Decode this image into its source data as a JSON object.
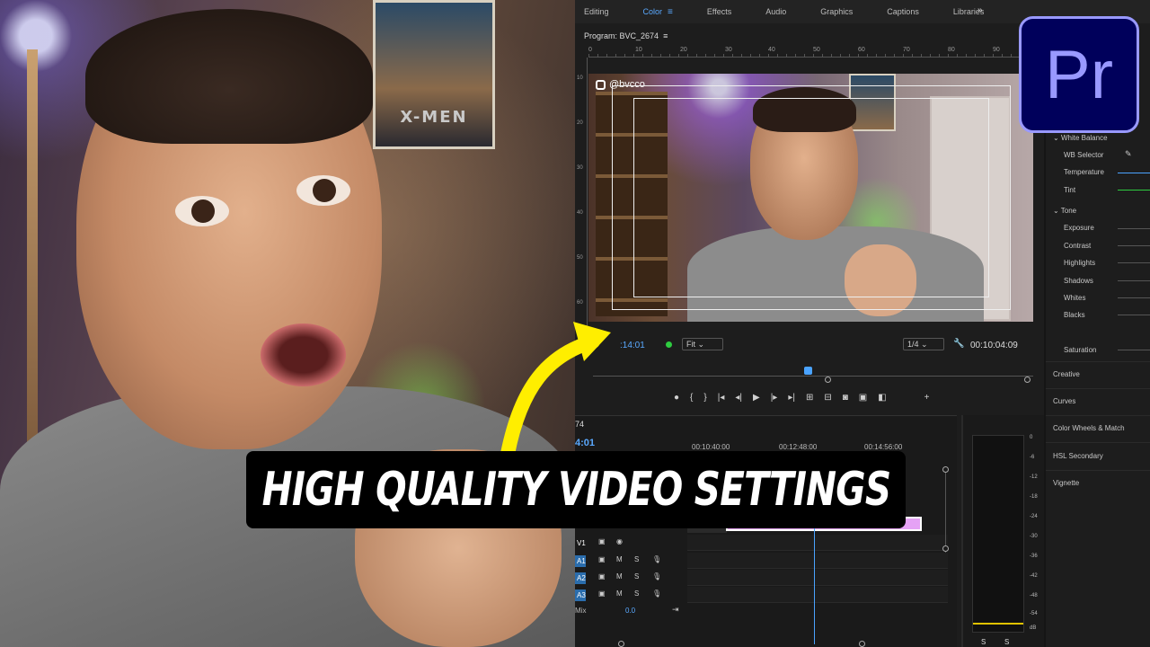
{
  "workspaces": {
    "tabs": [
      "Editing",
      "Color",
      "Effects",
      "Audio",
      "Graphics",
      "Captions",
      "Libraries"
    ],
    "active": "Color",
    "more_icon": "double-chevron-right-icon"
  },
  "program_monitor": {
    "title": "Program: BVC_2674",
    "ruler_labels": [
      "0",
      "10",
      "20",
      "30",
      "40",
      "50",
      "60",
      "70",
      "80",
      "90"
    ],
    "overlay_handle": "@bvcco",
    "current_timecode": ":14:01",
    "zoom": "Fit",
    "resolution": "1/4",
    "duration_timecode": "00:10:04:09"
  },
  "timeline": {
    "sequence_label": "74",
    "current_timecode": "4:01",
    "tick_labels": [
      "00:10:40:00",
      "00:12:48:00",
      "00:14:56:00"
    ],
    "tracks": [
      "V1",
      "A1",
      "A2",
      "A3"
    ],
    "track_buttons": [
      "M",
      "S"
    ],
    "mix_label": "Mix",
    "mix_value": "0.0"
  },
  "audio_meter": {
    "db_labels": [
      "0",
      "-6",
      "-12",
      "-18",
      "-24",
      "-30",
      "-36",
      "-42",
      "-48",
      "-54",
      "dB"
    ],
    "solo_labels": [
      "S",
      "S"
    ]
  },
  "lumetri": {
    "white_balance": "White Balance",
    "wb_selector": "WB Selector",
    "temperature": "Temperature",
    "tint": "Tint",
    "tone": "Tone",
    "exposure": "Exposure",
    "contrast": "Contrast",
    "highlights": "Highlights",
    "shadows": "Shadows",
    "whites": "Whites",
    "blacks": "Blacks",
    "saturation": "Saturation",
    "creative": "Creative",
    "curves": "Curves",
    "color_wheels": "Color Wheels & Match",
    "hsl": "HSL Secondary",
    "vignette": "Vignette"
  },
  "logo": "Pr",
  "thumbnail_title": "HIGH QUALITY VIDEO SETTINGS",
  "photo_poster_text": "X-MEN",
  "colors": {
    "accent_blue": "#5aa9ff",
    "arrow_yellow": "#ffee00",
    "clip_pink": "#e5a2f5",
    "premiere_purple": "#9999ff"
  }
}
